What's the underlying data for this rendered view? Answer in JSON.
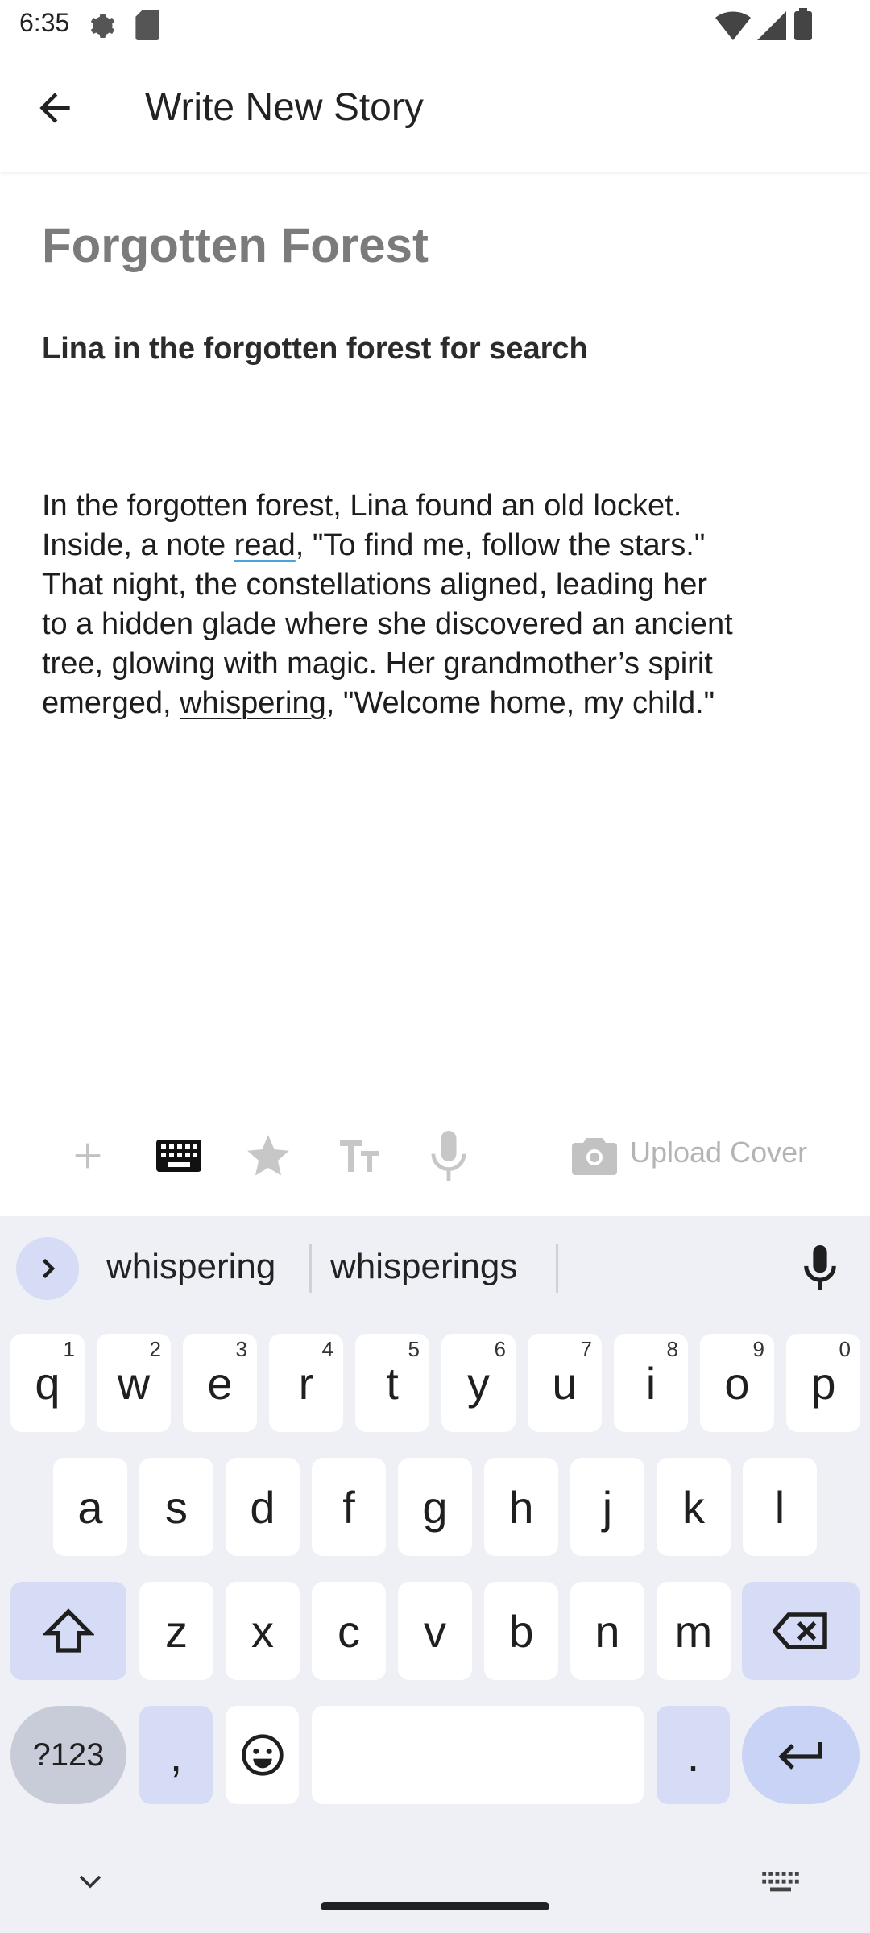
{
  "status_bar": {
    "time": "6:35"
  },
  "app_bar": {
    "title": "Write New Story"
  },
  "editor": {
    "title": "Forgotten Forest",
    "subtitle": "Lina in the forgotten forest for search",
    "body_parts": [
      "In the forgotten forest, Lina found an old locket.\nInside, a note ",
      "read",
      ", \"To find me, follow the stars.\"\nThat night, the constellations aligned, leading her\nto a hidden glade where she discovered an ancient\ntree, glowing with magic. Her grandmother’s spirit\nemerged, ",
      "whispering",
      ", \"Welcome home, my child.\""
    ]
  },
  "toolbar": {
    "upload_cover_label": "Upload Cover",
    "icons": [
      "add-icon",
      "keyboard-icon",
      "star-icon",
      "text-size-icon",
      "microphone-icon",
      "camera-icon"
    ]
  },
  "keyboard": {
    "suggestions": [
      "whispering",
      "whisperings"
    ],
    "row1": [
      {
        "k": "q",
        "h": "1"
      },
      {
        "k": "w",
        "h": "2"
      },
      {
        "k": "e",
        "h": "3"
      },
      {
        "k": "r",
        "h": "4"
      },
      {
        "k": "t",
        "h": "5"
      },
      {
        "k": "y",
        "h": "6"
      },
      {
        "k": "u",
        "h": "7"
      },
      {
        "k": "i",
        "h": "8"
      },
      {
        "k": "o",
        "h": "9"
      },
      {
        "k": "p",
        "h": "0"
      }
    ],
    "row2": [
      "a",
      "s",
      "d",
      "f",
      "g",
      "h",
      "j",
      "k",
      "l"
    ],
    "row3": [
      "z",
      "x",
      "c",
      "v",
      "b",
      "n",
      "m"
    ],
    "symbols_label": "?123",
    "comma": ",",
    "period": "."
  },
  "colors": {
    "accent": "#d6dcf5",
    "keyboard_bg": "#eff0f6",
    "spell_underline": "#4aa3df"
  }
}
